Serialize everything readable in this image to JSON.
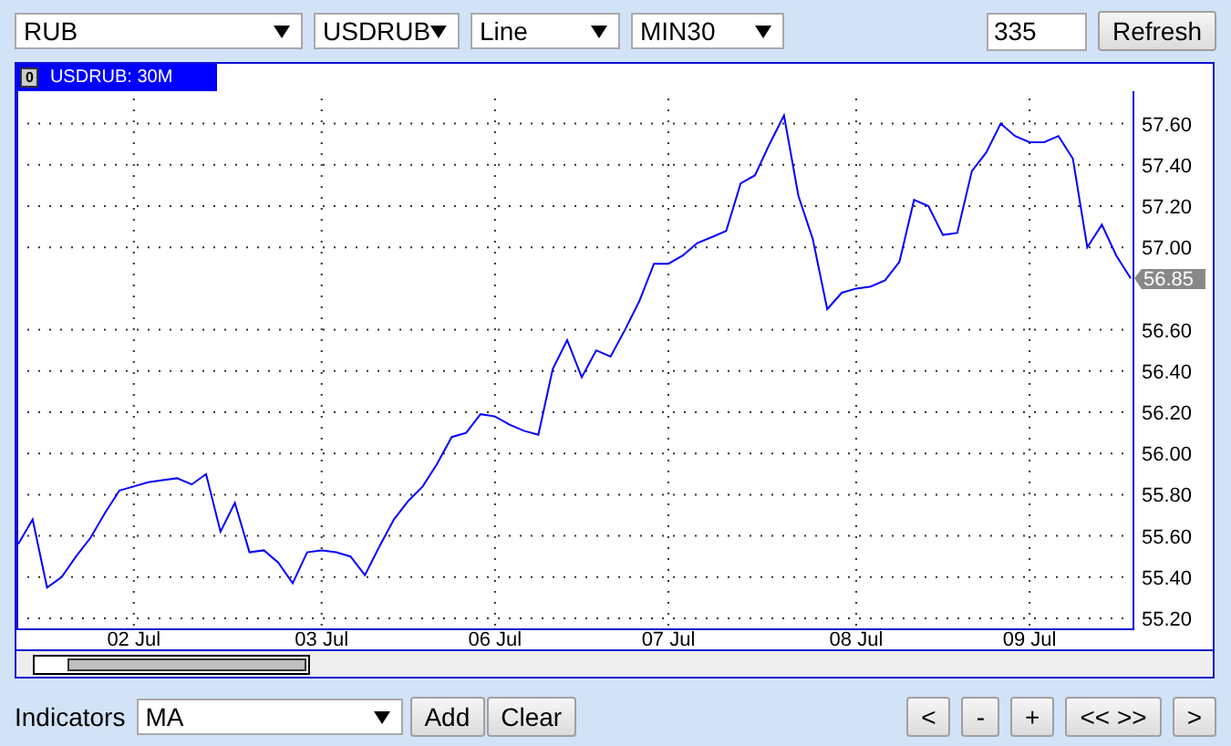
{
  "toolbar": {
    "selects": [
      {
        "value": "RUB"
      },
      {
        "value": "USDRUB"
      },
      {
        "value": "Line"
      },
      {
        "value": "MIN30"
      }
    ],
    "count": "335",
    "refresh": "Refresh"
  },
  "chart_panel": {
    "tab_icon": "0",
    "title": "USDRUB: 30M",
    "price_tag": "56.85",
    "chart_data": {
      "type": "line",
      "categories": [
        null,
        null,
        null,
        null,
        null,
        null,
        null,
        null,
        "02 Jul",
        null,
        null,
        null,
        null,
        null,
        null,
        null,
        null,
        null,
        null,
        null,
        null,
        "03 Jul",
        null,
        null,
        null,
        null,
        null,
        null,
        null,
        null,
        null,
        null,
        null,
        "06 Jul",
        null,
        null,
        null,
        null,
        null,
        null,
        null,
        null,
        null,
        null,
        null,
        "07 Jul",
        null,
        null,
        null,
        null,
        null,
        null,
        null,
        null,
        null,
        null,
        null,
        null,
        "08 Jul",
        null,
        null,
        null,
        null,
        null,
        null,
        null,
        null,
        null,
        null,
        null,
        "09 Jul",
        null,
        null,
        null,
        null,
        null,
        null,
        null
      ],
      "ylim": [
        55.15,
        57.72
      ],
      "grid": true,
      "yticks": [
        {
          "value": 55.2,
          "label": "55.20"
        },
        {
          "value": 55.4,
          "label": "55.40"
        },
        {
          "value": 55.6,
          "label": "55.60"
        },
        {
          "value": 55.8,
          "label": "55.80"
        },
        {
          "value": 56.0,
          "label": "56.00"
        },
        {
          "value": 56.2,
          "label": "56.20"
        },
        {
          "value": 56.4,
          "label": "56.40"
        },
        {
          "value": 56.6,
          "label": "56.60"
        },
        {
          "value": 57.0,
          "label": "57.00"
        },
        {
          "value": 57.2,
          "label": "57.20"
        },
        {
          "value": 57.4,
          "label": "57.40"
        },
        {
          "value": 57.6,
          "label": "57.60"
        }
      ],
      "series": [
        {
          "color": "#0000ff",
          "values": [
            55.56,
            55.68,
            55.35,
            55.4,
            55.5,
            55.59,
            55.71,
            55.82,
            55.84,
            55.86,
            55.87,
            55.88,
            55.85,
            55.9,
            55.62,
            55.76,
            55.52,
            55.53,
            55.47,
            55.37,
            55.52,
            55.53,
            55.52,
            55.5,
            55.41,
            55.55,
            55.68,
            55.77,
            55.84,
            55.95,
            56.08,
            56.1,
            56.19,
            56.18,
            56.14,
            56.11,
            56.09,
            56.41,
            56.55,
            56.37,
            56.5,
            56.47,
            56.6,
            56.74,
            56.92,
            56.92,
            56.96,
            57.02,
            57.05,
            57.08,
            57.31,
            57.35,
            57.5,
            57.64,
            57.25,
            57.04,
            56.7,
            56.78,
            56.8,
            56.81,
            56.84,
            56.93,
            57.23,
            57.2,
            57.06,
            57.07,
            57.37,
            57.46,
            57.6,
            57.54,
            57.51,
            57.51,
            57.54,
            57.43,
            57.0,
            57.11,
            56.96,
            56.85
          ]
        }
      ]
    }
  },
  "bottom": {
    "indicators_label": "Indicators",
    "indicator": "MA",
    "add": "Add",
    "clear": "Clear",
    "nav": [
      "<",
      "-",
      "+",
      "<< >>",
      ">"
    ]
  }
}
